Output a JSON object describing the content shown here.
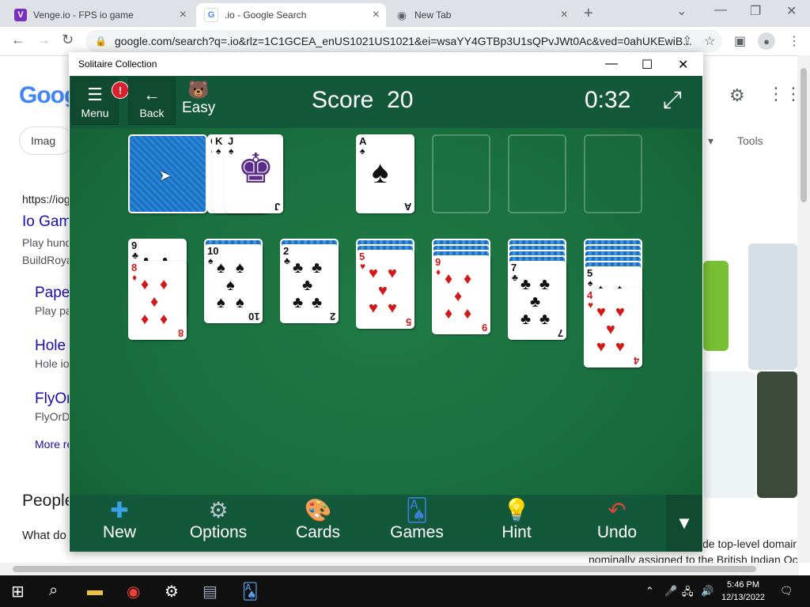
{
  "browser": {
    "tabs": [
      {
        "title": "Venge.io - FPS io game",
        "favicon": "V",
        "color": "#7b2fbe"
      },
      {
        "title": ".io - Google Search",
        "favicon": "G",
        "color": "#4285f4"
      },
      {
        "title": "New Tab",
        "favicon": "◉",
        "color": "#5f6368"
      }
    ],
    "url": "google.com/search?q=.io&rlz=1C1GCEA_enUS1021US1021&ei=wsaYY4GTBp3U1sQPvJWt0Ac&ved=0ahUKEwiB..."
  },
  "google": {
    "logo": "Goog",
    "chip": "Imag",
    "result_url": "https://iog",
    "result_title": "Io Gam",
    "result_snippet_1": "Play hund",
    "result_snippet_2": "BuildRoya",
    "sub1_title": "Pape",
    "sub1_snippet": "Play pa",
    "sub2_title": "Hole",
    "sub2_snippet": "Hole io",
    "sub3_title": "FlyOr",
    "sub3_snippet": "FlyOrDi",
    "more": "More re",
    "people": "People",
    "whatdo": "What do",
    "tools": "Tools",
    "bottom_snippet_1": "de top-level domair",
    "bottom_snippet_2": "nominally assigned to the British Indian Oc"
  },
  "solitaire": {
    "window_title": "Solitaire Collection",
    "menu_label": "Menu",
    "menu_badge": "!",
    "back_label": "Back",
    "difficulty": "Easy",
    "score_label": "Score",
    "score_value": "20",
    "timer": "0:32",
    "waste": [
      {
        "rank": "Q",
        "suit": "♣",
        "color": "black"
      },
      {
        "rank": "K",
        "suit": "♠",
        "color": "black"
      },
      {
        "rank": "J",
        "suit": "♠",
        "color": "black"
      }
    ],
    "foundation_1": {
      "rank": "A",
      "suit": "♠",
      "color": "black"
    },
    "tableau": [
      {
        "cards": [
          {
            "rank": "9",
            "suit": "♣",
            "color": "black"
          },
          {
            "rank": "8",
            "suit": "♦",
            "color": "red"
          }
        ]
      },
      {
        "hidden": 1,
        "cards": [
          {
            "rank": "10",
            "suit": "♠",
            "color": "black"
          }
        ]
      },
      {
        "hidden": 1,
        "cards": [
          {
            "rank": "2",
            "suit": "♣",
            "color": "black"
          }
        ]
      },
      {
        "hidden": 2,
        "cards": [
          {
            "rank": "5",
            "suit": "♥",
            "color": "red"
          }
        ]
      },
      {
        "hidden": 3,
        "cards": [
          {
            "rank": "9",
            "suit": "♦",
            "color": "red"
          }
        ]
      },
      {
        "hidden": 4,
        "cards": [
          {
            "rank": "7",
            "suit": "♣",
            "color": "black"
          }
        ]
      },
      {
        "hidden": 5,
        "cards": [
          {
            "rank": "5",
            "suit": "♠",
            "color": "black"
          },
          {
            "rank": "4",
            "suit": "♥",
            "color": "red"
          }
        ]
      }
    ],
    "bottom_buttons": [
      {
        "label": "New",
        "icon": "plus-icon"
      },
      {
        "label": "Options",
        "icon": "gear-icon"
      },
      {
        "label": "Cards",
        "icon": "palette-icon"
      },
      {
        "label": "Games",
        "icon": "cards-icon"
      },
      {
        "label": "Hint",
        "icon": "lightbulb-icon"
      },
      {
        "label": "Undo",
        "icon": "undo-icon"
      }
    ]
  },
  "taskbar": {
    "time": "5:46 PM",
    "date": "12/13/2022"
  }
}
